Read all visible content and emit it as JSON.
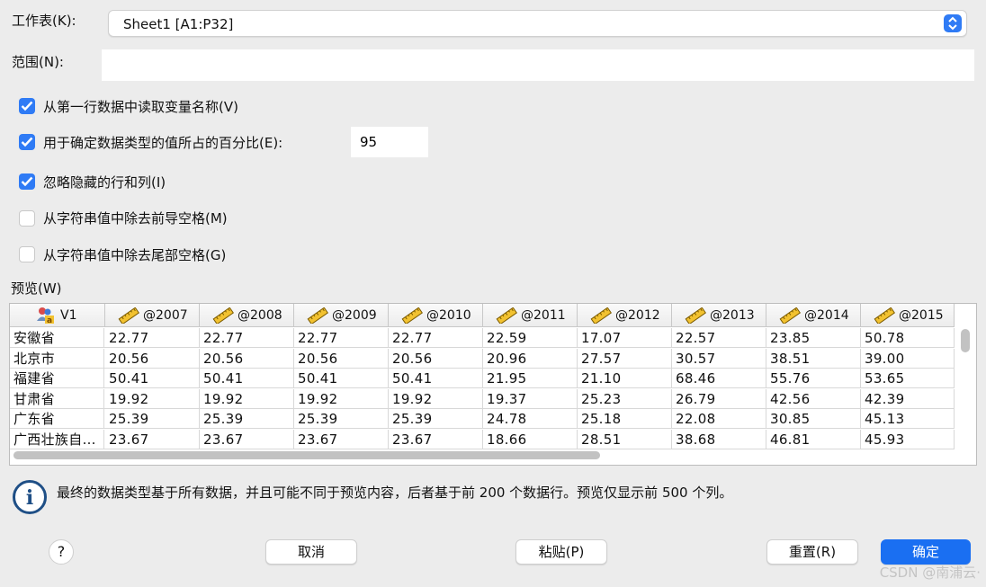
{
  "worksheet": {
    "label": "工作表(K):",
    "selected": "Sheet1 [A1:P32]"
  },
  "range": {
    "label": "范围(N):",
    "value": ""
  },
  "options": [
    {
      "label": "从第一行数据中读取变量名称(V)",
      "checked": true
    },
    {
      "label": "用于确定数据类型的值所占的百分比(E):",
      "checked": true,
      "value": "95"
    },
    {
      "label": "忽略隐藏的行和列(I)",
      "checked": true
    },
    {
      "label": "从字符串值中除去前导空格(M)",
      "checked": false
    },
    {
      "label": "从字符串值中除去尾部空格(G)",
      "checked": false
    }
  ],
  "preview": {
    "label": "预览(W)",
    "columns": [
      "V1",
      "@2007",
      "@2008",
      "@2009",
      "@2010",
      "@2011",
      "@2012",
      "@2013",
      "@2014",
      "@2015"
    ],
    "rows": [
      [
        "安徽省",
        "22.77",
        "22.77",
        "22.77",
        "22.77",
        "22.59",
        "17.07",
        "22.57",
        "23.85",
        "50.78"
      ],
      [
        "北京市",
        "20.56",
        "20.56",
        "20.56",
        "20.56",
        "20.96",
        "27.57",
        "30.57",
        "38.51",
        "39.00"
      ],
      [
        "福建省",
        "50.41",
        "50.41",
        "50.41",
        "50.41",
        "21.95",
        "21.10",
        "68.46",
        "55.76",
        "53.65"
      ],
      [
        "甘肃省",
        "19.92",
        "19.92",
        "19.92",
        "19.92",
        "19.37",
        "25.23",
        "26.79",
        "42.56",
        "42.39"
      ],
      [
        "广东省",
        "25.39",
        "25.39",
        "25.39",
        "25.39",
        "24.78",
        "25.18",
        "22.08",
        "30.85",
        "45.13"
      ],
      [
        "广西壮族自…",
        "23.67",
        "23.67",
        "23.67",
        "23.67",
        "18.66",
        "28.51",
        "38.68",
        "46.81",
        "45.93"
      ]
    ]
  },
  "info": {
    "text": "最终的数据类型基于所有数据，并且可能不同于预览内容，后者基于前 200 个数据行。预览仅显示前 500 个列。"
  },
  "buttons": {
    "help": "?",
    "cancel": "取消",
    "paste": "粘贴(P)",
    "reset": "重置(R)",
    "ok": "确定"
  },
  "watermark": "CSDN @南浦云·",
  "colors": {
    "accent": "#2f7bf5",
    "primary_button": "#1a6ff2",
    "info_icon": "#1f4f86"
  }
}
